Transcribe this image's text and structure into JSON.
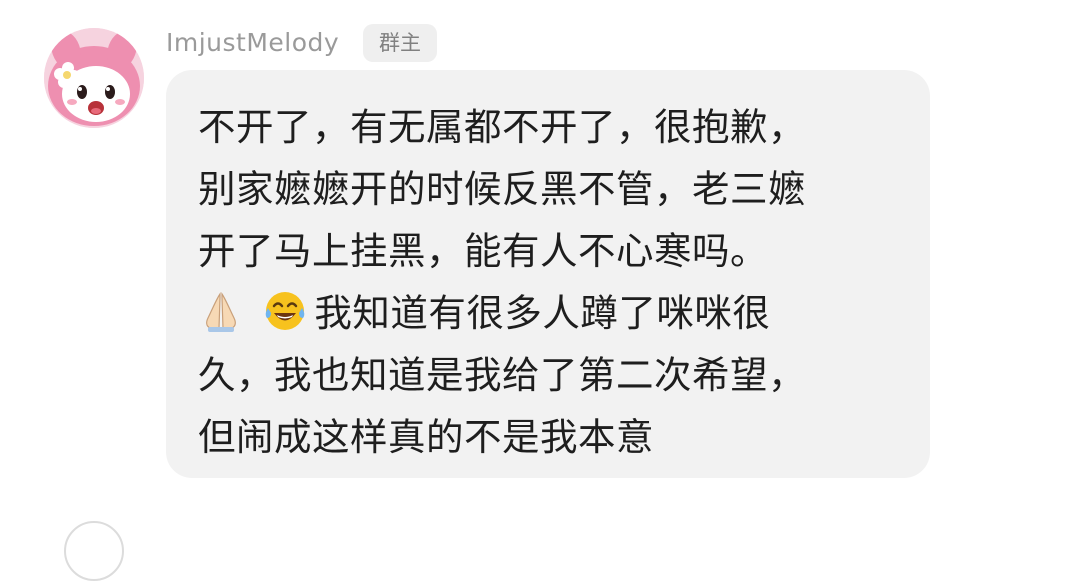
{
  "message": {
    "sender": {
      "name": "ImjustMelody",
      "role_badge": "群主",
      "avatar_icon": "my-melody-avatar-icon"
    },
    "text_lines": [
      "不开了，有无属都不开了，很抱歉，",
      "别家嬷嬷开的时候反黑不管，老三嬷",
      "开了马上挂黑，能有人不心寒吗。",
      "我知道有很多人蹲了咪咪很",
      "久，我也知道是我给了第二次希望，",
      "但闹成这样真的不是我本意"
    ],
    "emojis": [
      "folded-hands-icon",
      "tears-of-joy-icon"
    ]
  },
  "colors": {
    "bubble_background": "#f2f2f2",
    "name_text": "#9a9a9a",
    "badge_background": "#efefef",
    "message_text": "#1e1e1e"
  }
}
